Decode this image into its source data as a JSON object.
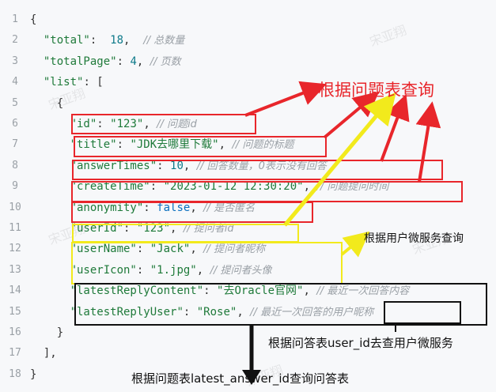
{
  "code_lines": [
    {
      "num": "1",
      "tokens": [
        {
          "t": "{",
          "c": "p"
        }
      ]
    },
    {
      "num": "2",
      "tokens": [
        {
          "t": "  ",
          "c": "p"
        },
        {
          "t": "\"total\"",
          "c": "k"
        },
        {
          "t": ":  ",
          "c": "p"
        },
        {
          "t": "18",
          "c": "n"
        },
        {
          "t": ",  ",
          "c": "p"
        },
        {
          "t": "// 总数量",
          "c": "c"
        }
      ]
    },
    {
      "num": "3",
      "tokens": [
        {
          "t": "  ",
          "c": "p"
        },
        {
          "t": "\"totalPage\"",
          "c": "k"
        },
        {
          "t": ": ",
          "c": "p"
        },
        {
          "t": "4",
          "c": "n"
        },
        {
          "t": ", ",
          "c": "p"
        },
        {
          "t": "// 页数",
          "c": "c"
        }
      ]
    },
    {
      "num": "4",
      "tokens": [
        {
          "t": "  ",
          "c": "p"
        },
        {
          "t": "\"list\"",
          "c": "k"
        },
        {
          "t": ": [",
          "c": "p"
        }
      ]
    },
    {
      "num": "5",
      "tokens": [
        {
          "t": "    {",
          "c": "p"
        }
      ]
    },
    {
      "num": "6",
      "tokens": [
        {
          "t": "      ",
          "c": "p"
        },
        {
          "t": "\"id\"",
          "c": "k"
        },
        {
          "t": ": ",
          "c": "p"
        },
        {
          "t": "\"123\"",
          "c": "s"
        },
        {
          "t": ", ",
          "c": "p"
        },
        {
          "t": "// 问题id",
          "c": "c"
        }
      ]
    },
    {
      "num": "7",
      "tokens": [
        {
          "t": "      ",
          "c": "p"
        },
        {
          "t": "\"title\"",
          "c": "k"
        },
        {
          "t": ": ",
          "c": "p"
        },
        {
          "t": "\"JDK去哪里下载\"",
          "c": "s"
        },
        {
          "t": ", ",
          "c": "p"
        },
        {
          "t": "// 问题的标题",
          "c": "c"
        }
      ]
    },
    {
      "num": "8",
      "tokens": [
        {
          "t": "      ",
          "c": "p"
        },
        {
          "t": "\"answerTimes\"",
          "c": "k"
        },
        {
          "t": ": ",
          "c": "p"
        },
        {
          "t": "10",
          "c": "n"
        },
        {
          "t": ", ",
          "c": "p"
        },
        {
          "t": "// 回答数量，0表示没有回答",
          "c": "c"
        }
      ]
    },
    {
      "num": "9",
      "tokens": [
        {
          "t": "      ",
          "c": "p"
        },
        {
          "t": "\"createTime\"",
          "c": "k"
        },
        {
          "t": ": ",
          "c": "p"
        },
        {
          "t": "\"2023-01-12 12:30:20\"",
          "c": "s"
        },
        {
          "t": ", ",
          "c": "p"
        },
        {
          "t": "// 问题提问时间",
          "c": "c"
        }
      ]
    },
    {
      "num": "10",
      "tokens": [
        {
          "t": "      ",
          "c": "p"
        },
        {
          "t": "\"anonymity\"",
          "c": "k"
        },
        {
          "t": ": ",
          "c": "p"
        },
        {
          "t": "false",
          "c": "b"
        },
        {
          "t": ", ",
          "c": "p"
        },
        {
          "t": "// 是否匿名",
          "c": "c"
        }
      ]
    },
    {
      "num": "11",
      "tokens": [
        {
          "t": "      ",
          "c": "p"
        },
        {
          "t": "\"userId\"",
          "c": "k"
        },
        {
          "t": ": ",
          "c": "p"
        },
        {
          "t": "\"123\"",
          "c": "s"
        },
        {
          "t": ", ",
          "c": "p"
        },
        {
          "t": "// 提问者id",
          "c": "c"
        }
      ]
    },
    {
      "num": "12",
      "tokens": [
        {
          "t": "      ",
          "c": "p"
        },
        {
          "t": "\"userName\"",
          "c": "k"
        },
        {
          "t": ": ",
          "c": "p"
        },
        {
          "t": "\"Jack\"",
          "c": "s"
        },
        {
          "t": ", ",
          "c": "p"
        },
        {
          "t": "// 提问者昵称",
          "c": "c"
        }
      ]
    },
    {
      "num": "13",
      "tokens": [
        {
          "t": "      ",
          "c": "p"
        },
        {
          "t": "\"userIcon\"",
          "c": "k"
        },
        {
          "t": ": ",
          "c": "p"
        },
        {
          "t": "\"1.jpg\"",
          "c": "s"
        },
        {
          "t": ", ",
          "c": "p"
        },
        {
          "t": "// 提问者头像",
          "c": "c"
        }
      ]
    },
    {
      "num": "14",
      "tokens": [
        {
          "t": "      ",
          "c": "p"
        },
        {
          "t": "\"latestReplyContent\"",
          "c": "k"
        },
        {
          "t": ": ",
          "c": "p"
        },
        {
          "t": "\"去Oracle官网\"",
          "c": "s"
        },
        {
          "t": ", ",
          "c": "p"
        },
        {
          "t": "// 最近一次回答内容",
          "c": "c"
        }
      ]
    },
    {
      "num": "15",
      "tokens": [
        {
          "t": "      ",
          "c": "p"
        },
        {
          "t": "\"latestReplyUser\"",
          "c": "k"
        },
        {
          "t": ": ",
          "c": "p"
        },
        {
          "t": "\"Rose\"",
          "c": "s"
        },
        {
          "t": ", ",
          "c": "p"
        },
        {
          "t": "// 最近一次回答的用户昵称",
          "c": "c"
        }
      ]
    },
    {
      "num": "16",
      "tokens": [
        {
          "t": "    }",
          "c": "p"
        }
      ]
    },
    {
      "num": "17",
      "tokens": [
        {
          "t": "  ],",
          "c": "p"
        }
      ]
    },
    {
      "num": "18",
      "tokens": [
        {
          "t": "}",
          "c": "p"
        }
      ]
    }
  ],
  "annotations": {
    "red_label": "根据问题表查询",
    "yellow_label": "根据用户微服务查询",
    "black_label_1": "根据问答表user_id去查用户微服务",
    "black_label_2": "根据问题表latest_answer_id查询问答表"
  },
  "colors": {
    "red": "#e8262b",
    "yellow": "#f2ea1c",
    "black": "#111111",
    "bg": "#f7f8fa"
  },
  "watermark": "宋亚翔"
}
